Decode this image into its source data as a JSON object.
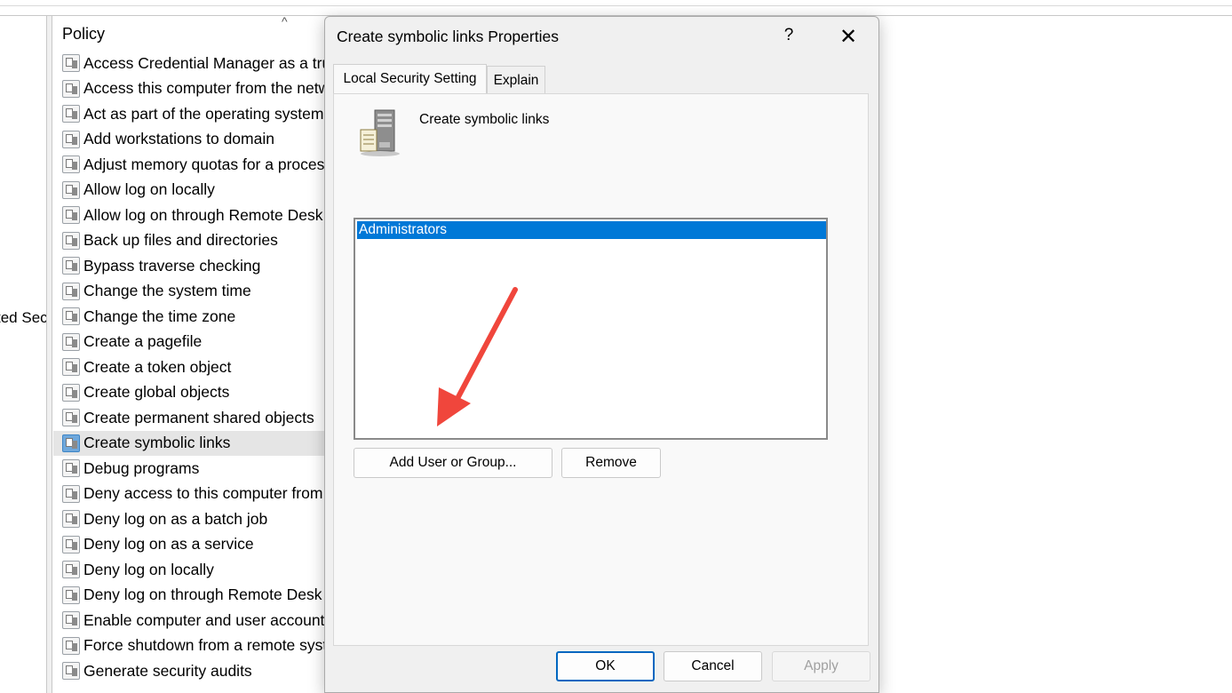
{
  "left_pane": {
    "tree_text": "ted Sec"
  },
  "list": {
    "column_header": "Policy",
    "sort_indicator": "^",
    "rows": [
      {
        "label": "Access Credential Manager as a trus"
      },
      {
        "label": "Access this computer from the netw"
      },
      {
        "label": "Act as part of the operating system"
      },
      {
        "label": "Add workstations to domain"
      },
      {
        "label": "Adjust memory quotas for a proces"
      },
      {
        "label": "Allow log on locally"
      },
      {
        "label": "Allow log on through Remote Desk"
      },
      {
        "label": "Back up files and directories"
      },
      {
        "label": "Bypass traverse checking"
      },
      {
        "label": "Change the system time"
      },
      {
        "label": "Change the time zone"
      },
      {
        "label": "Create a pagefile"
      },
      {
        "label": "Create a token object"
      },
      {
        "label": "Create global objects"
      },
      {
        "label": "Create permanent shared objects"
      },
      {
        "label": "Create symbolic links",
        "selected": true
      },
      {
        "label": "Debug programs"
      },
      {
        "label": "Deny access to this computer from"
      },
      {
        "label": "Deny log on as a batch job"
      },
      {
        "label": "Deny log on as a service"
      },
      {
        "label": "Deny log on locally"
      },
      {
        "label": "Deny log on through Remote Desk"
      },
      {
        "label": "Enable computer and user account"
      },
      {
        "label": "Force shutdown from a remote syst"
      },
      {
        "label": "Generate security audits"
      }
    ]
  },
  "dialog": {
    "title": "Create symbolic links Properties",
    "help_glyph": "?",
    "close_glyph": "✕",
    "tabs": [
      {
        "label": "Local Security Setting",
        "active": true
      },
      {
        "label": "Explain",
        "active": false
      }
    ],
    "policy_name": "Create symbolic links",
    "policy_icon": "server-policy-icon",
    "members": [
      "Administrators"
    ],
    "add_button": "Add User or Group...",
    "remove_button": "Remove",
    "ok_button": "OK",
    "cancel_button": "Cancel",
    "apply_button": "Apply"
  },
  "annotation": {
    "arrow_color": "#f0463c"
  }
}
